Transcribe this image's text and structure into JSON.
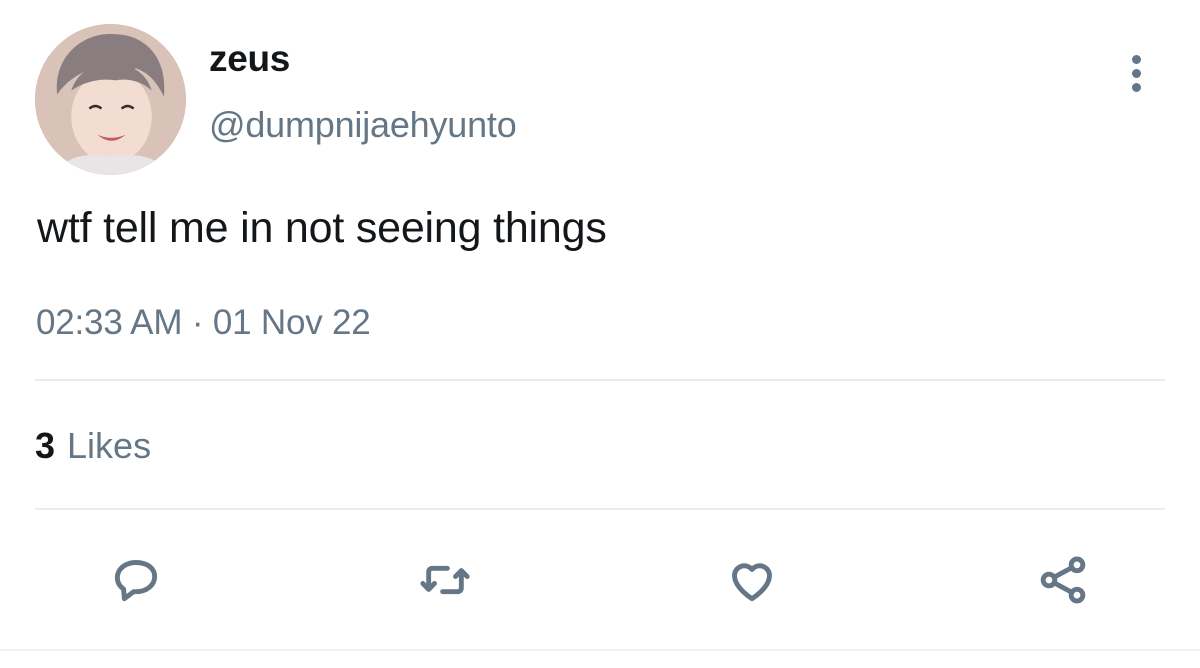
{
  "user": {
    "display_name": "zeus",
    "handle": "@dumpnijaehyunto"
  },
  "tweet": {
    "text": "wtf tell me in not seeing things",
    "time": "02:33 AM",
    "separator": "·",
    "date": "01 Nov 22"
  },
  "stats": {
    "likes_count": "3",
    "likes_label": "Likes"
  },
  "icons": {
    "more": "more-vertical-icon",
    "reply": "reply-icon",
    "retweet": "retweet-icon",
    "like": "heart-icon",
    "share": "share-icon"
  },
  "colors": {
    "text_primary": "#14171a",
    "text_secondary": "#657786",
    "divider": "#e6ecf0"
  }
}
